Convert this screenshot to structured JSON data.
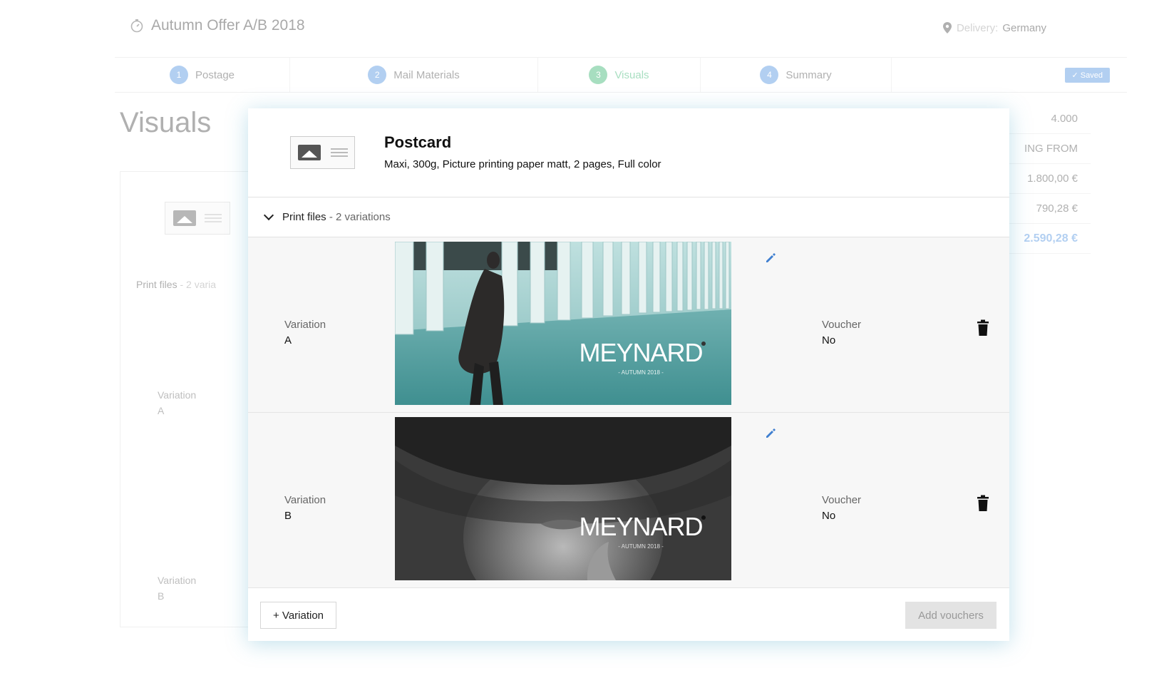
{
  "header": {
    "campaign_title": "Autumn Offer A/B 2018",
    "delivery_label": "Delivery:",
    "delivery_value": "Germany"
  },
  "stepper": {
    "steps": [
      {
        "num": "1",
        "label": "Postage"
      },
      {
        "num": "2",
        "label": "Mail Materials"
      },
      {
        "num": "3",
        "label": "Visuals"
      },
      {
        "num": "4",
        "label": "Summary"
      }
    ],
    "saved_label": "✓ Saved"
  },
  "background": {
    "page_title": "Visuals",
    "print_files_label": "Print files",
    "print_files_count": "- 2 varia",
    "variation_a": {
      "label": "Variation",
      "value": "A"
    },
    "variation_b": {
      "label": "Variation",
      "value": "B"
    },
    "price_rows": [
      "4.000",
      "ING FROM",
      "1.800,00 €",
      "790,28 €",
      "2.590,28 €"
    ]
  },
  "modal": {
    "title": "Postcard",
    "subtitle": "Maxi, 300g, Picture printing paper matt, 2 pages, Full color",
    "print_files_label": "Print files",
    "print_files_count": "- 2 variations",
    "variations": [
      {
        "label": "Variation",
        "value": "A",
        "voucher_label": "Voucher",
        "voucher_value": "No",
        "brand": "MEYNARD",
        "brand_sub": "- AUTUMN 2018 -"
      },
      {
        "label": "Variation",
        "value": "B",
        "voucher_label": "Voucher",
        "voucher_value": "No",
        "brand": "MEYNARD",
        "brand_sub": "- AUTUMN 2018 -"
      }
    ],
    "add_variation_label": "+ Variation",
    "add_vouchers_label": "Add vouchers"
  },
  "colors": {
    "accent_blue": "#4a8fe0",
    "step_active": "#2fb26a",
    "modal_glow": "#50aac8"
  },
  "icons": [
    "timer-icon",
    "location-pin-icon",
    "image-icon",
    "chevron-down-icon",
    "pencil-icon",
    "trash-icon"
  ]
}
